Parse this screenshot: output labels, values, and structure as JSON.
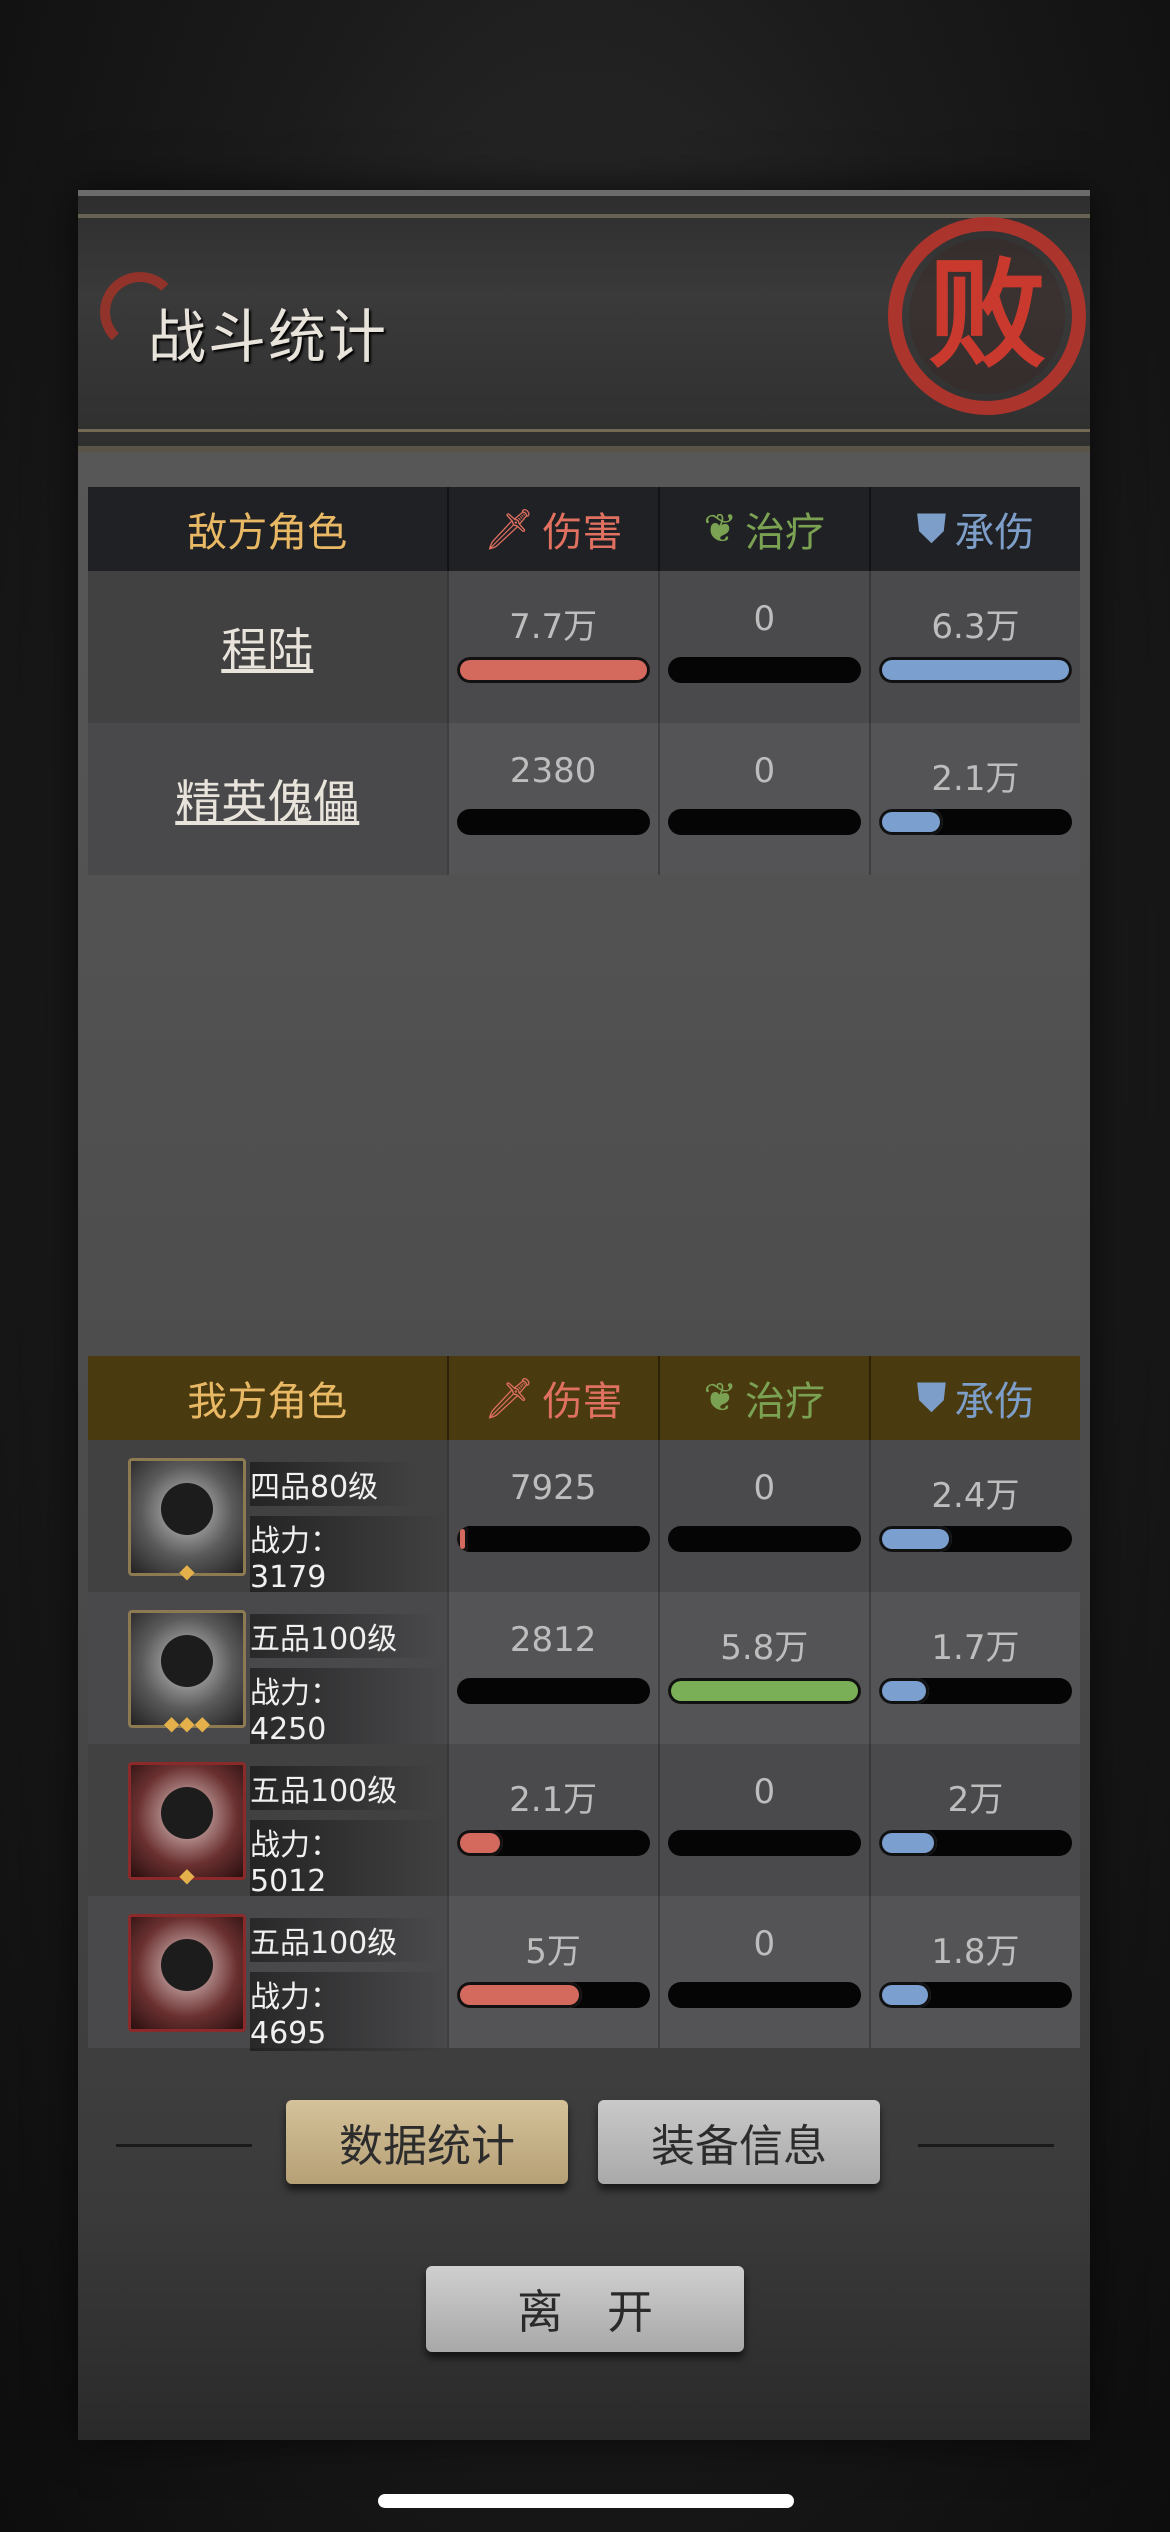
{
  "title": "战斗统计",
  "seal_char": "败",
  "columns": {
    "damage": "伤害",
    "heal": "治疗",
    "tank": "承伤"
  },
  "enemy": {
    "header": "敌方角色",
    "rows": [
      {
        "name": "程陆",
        "damage": "7.7万",
        "heal": "0",
        "tank": "6.3万",
        "damage_ratio": 1.0,
        "heal_ratio": 0,
        "tank_ratio": 1.0
      },
      {
        "name": "精英傀儡",
        "damage": "2380",
        "heal": "0",
        "tank": "2.1万",
        "damage_ratio": 0,
        "heal_ratio": 0,
        "tank_ratio": 0.33
      }
    ]
  },
  "ally": {
    "header": "我方角色",
    "rows": [
      {
        "rank": "四品80级",
        "power": "战力：3179",
        "damage": "7925",
        "heal": "0",
        "tank": "2.4万",
        "damage_ratio": 0.06,
        "heal_ratio": 0,
        "tank_ratio": 0.38,
        "gems": "◆",
        "frame": "gold"
      },
      {
        "rank": "五品100级",
        "power": "战力：4250",
        "damage": "2812",
        "heal": "5.8万",
        "tank": "1.7万",
        "damage_ratio": 0,
        "heal_ratio": 1.0,
        "tank_ratio": 0.26,
        "gems": "◆◆◆",
        "frame": "gold"
      },
      {
        "rank": "五品100级",
        "power": "战力：5012",
        "damage": "2.1万",
        "heal": "0",
        "tank": "2万",
        "damage_ratio": 0.24,
        "heal_ratio": 0,
        "tank_ratio": 0.3,
        "gems": "◆",
        "frame": "red"
      },
      {
        "rank": "五品100级",
        "power": "战力：4695",
        "damage": "5万",
        "heal": "0",
        "tank": "1.8万",
        "damage_ratio": 0.65,
        "heal_ratio": 0,
        "tank_ratio": 0.27,
        "gems": "",
        "frame": "red"
      }
    ]
  },
  "tabs": {
    "active": "数据统计",
    "inactive": "装备信息"
  },
  "leave_button": "离开",
  "colors": {
    "damage": "#d46a5e",
    "heal": "#7aaf58",
    "tank": "#7b9fcf",
    "enemy_header": "#202124",
    "ally_header": "#4a3a10",
    "gold_text": "#e8b864"
  }
}
